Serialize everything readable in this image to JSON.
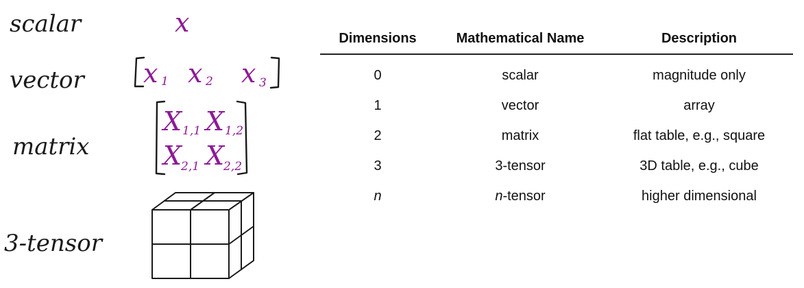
{
  "left": {
    "labels": {
      "scalar": "scalar",
      "vector": "vector",
      "matrix": "matrix",
      "tensor": "3-tensor"
    },
    "scalar_expr": "x",
    "vector_expr": {
      "v1": "x",
      "s1": "1",
      "v2": "x",
      "s2": "2",
      "v3": "x",
      "s3": "3"
    },
    "matrix_expr": {
      "v11": "X",
      "s11": "1,1",
      "v12": "X",
      "s12": "1,2",
      "v21": "X",
      "s21": "2,1",
      "v22": "X",
      "s22": "2,2"
    }
  },
  "table": {
    "headers": [
      "Dimensions",
      "Mathematical Name",
      "Description"
    ],
    "rows": [
      {
        "dim": "0",
        "name": "scalar",
        "name_suffix": "",
        "desc": "magnitude only"
      },
      {
        "dim": "1",
        "name": "vector",
        "name_suffix": "",
        "desc": "array"
      },
      {
        "dim": "2",
        "name": "matrix",
        "name_suffix": "",
        "desc": "flat table, e.g., square"
      },
      {
        "dim": "3",
        "name": "3-tensor",
        "name_suffix": "",
        "desc": "3D table, e.g., cube"
      },
      {
        "dim": "n",
        "name": "n",
        "name_suffix": "-tensor",
        "desc": "higher dimensional"
      }
    ]
  },
  "colors": {
    "math": "#8d1a96",
    "ink": "#1a1a1a"
  }
}
